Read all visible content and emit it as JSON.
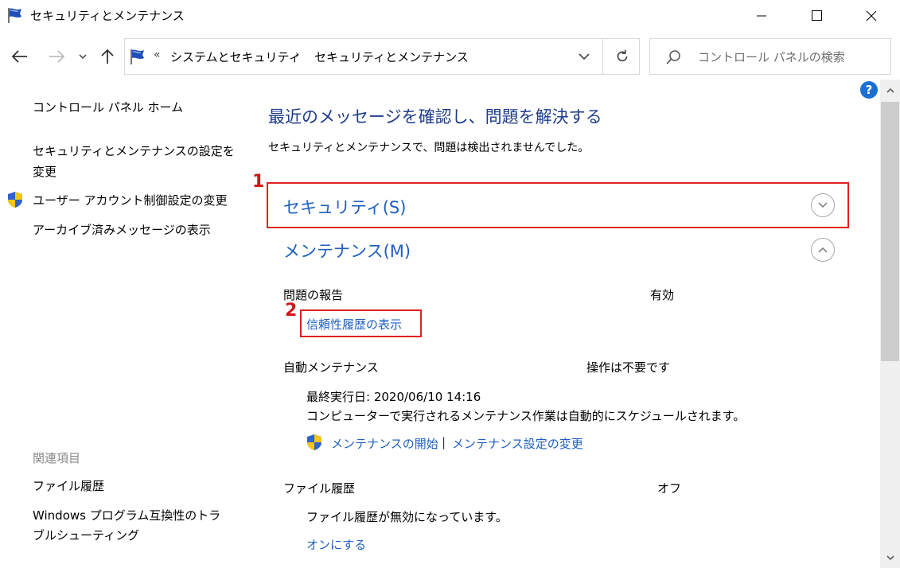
{
  "window": {
    "title": "セキュリティとメンテナンス"
  },
  "address_bar": {
    "overflow": "«",
    "crumb1": "システムとセキュリティ",
    "separator": "›",
    "crumb2": "セキュリティとメンテナンス"
  },
  "search": {
    "placeholder": "コントロール パネルの検索"
  },
  "left_pane": {
    "home": "コントロール パネル ホーム",
    "settings_line1": "セキュリティとメンテナンスの設定を",
    "settings_line2": "変更",
    "uac": "ユーザー アカウント制御設定の変更",
    "archived": "アーカイブ済みメッセージの表示",
    "related_heading": "関連項目",
    "file_history": "ファイル履歴",
    "compat_line1": "Windows プログラム互換性のトラ",
    "compat_line2": "ブルシューティング"
  },
  "main": {
    "title": "最近のメッセージを確認し、問題を解決する",
    "subtitle": "セキュリティとメンテナンスで、問題は検出されませんでした。",
    "security_title": "セキュリティ(S)",
    "maintenance_title": "メンテナンス(M)",
    "problem_report_label": "問題の報告",
    "problem_report_value": "有効",
    "reliability_link": "信頼性履歴の表示",
    "auto_maint_label": "自動メンテナンス",
    "auto_maint_value": "操作は不要です",
    "last_run": "最終実行日: 2020/06/10 14:16",
    "auto_desc": "コンピューターで実行されるメンテナンス作業は自動的にスケジュールされます。",
    "start_maint_link": "メンテナンスの開始",
    "link_divider": "|",
    "change_maint_link": "メンテナンス設定の変更",
    "file_history_label": "ファイル履歴",
    "file_history_value": "オフ",
    "file_history_desc": "ファイル履歴が無効になっています。",
    "turn_on_link": "オンにする"
  },
  "annotations": {
    "num1": "1",
    "num2": "2"
  },
  "help": "?",
  "colors": {
    "accent_link": "#1f5fbf",
    "title_blue": "#1e3c8c",
    "annotation_red": "#e02020"
  }
}
